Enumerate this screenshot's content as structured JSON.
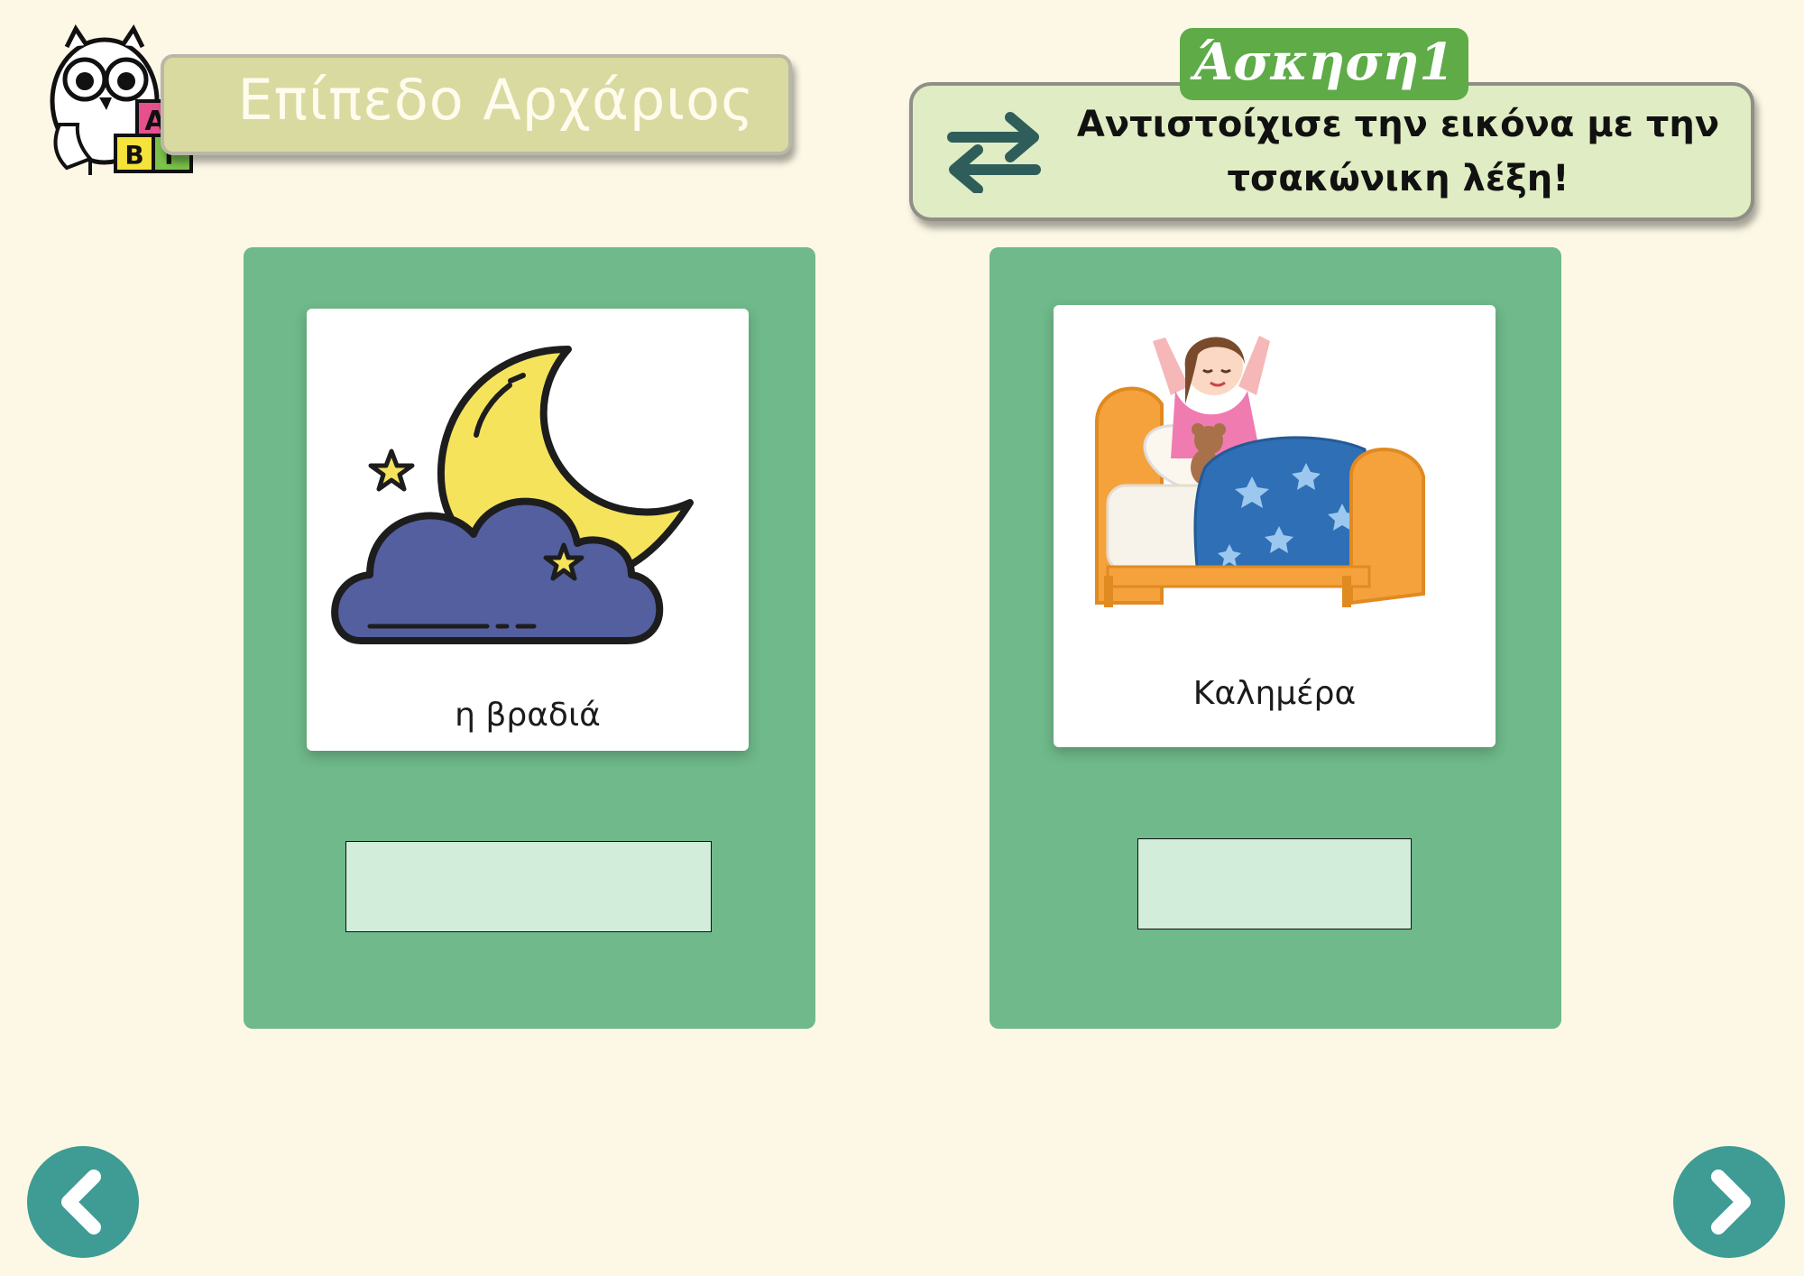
{
  "level": {
    "title": "Επίπεδο Αρχάριος"
  },
  "mascot": {
    "letters": [
      "Α",
      "Β",
      "Γ"
    ]
  },
  "exercise": {
    "tag": "Άσκηση1",
    "instruction_line1": "Αντιστοίχισε την εικόνα με την",
    "instruction_line2": "τσακώνικη λέξη!"
  },
  "cards": [
    {
      "caption": "η βραδιά",
      "image": "moon-cloud-icon"
    },
    {
      "caption": "Καλημέρα",
      "image": "girl-waking-up-in-bed"
    }
  ],
  "navigation": {
    "prev_icon": "chevron-left-icon",
    "next_icon": "chevron-right-icon"
  },
  "colors": {
    "background": "#fdf8e6",
    "card": "#6fb98a",
    "drop_box": "#d3eddb",
    "nav_button": "#3e9c94",
    "exercise_tag": "#5eab48",
    "instruction_box": "#e0ecc3",
    "level_banner": "#d9daa0"
  }
}
